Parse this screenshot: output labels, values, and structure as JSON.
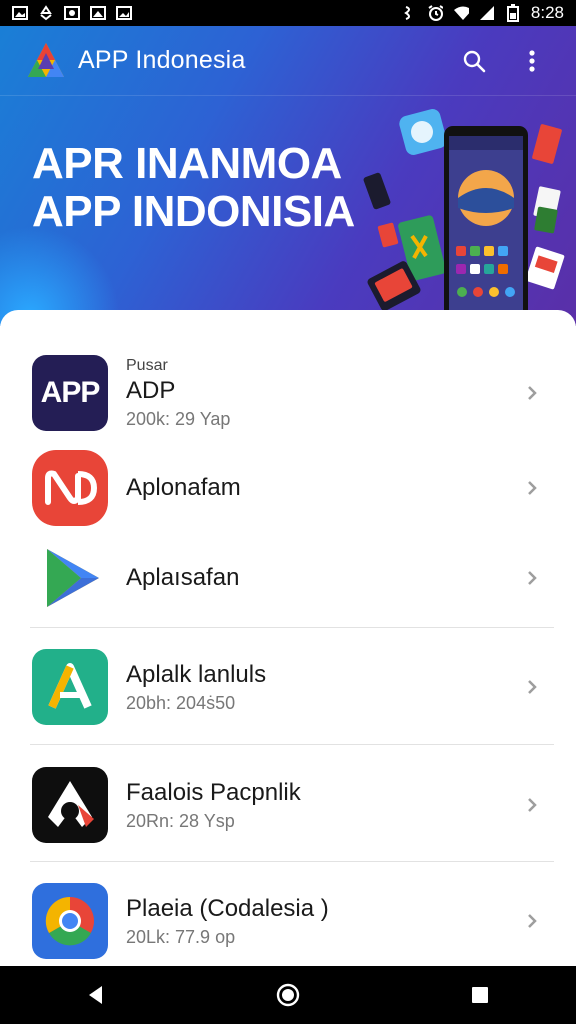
{
  "status_bar": {
    "time": "8:28",
    "left_icons": [
      "gallery-icon",
      "recycle-icon",
      "image-icon",
      "image-icon",
      "image-icon"
    ],
    "right_icons": [
      "vibrate-icon",
      "alarm-icon",
      "wifi-icon",
      "signal-icon",
      "battery-icon"
    ]
  },
  "app_bar": {
    "title": "APP Indonesia",
    "actions": [
      "search-icon",
      "more-vert-icon"
    ]
  },
  "hero": {
    "line1": "APR INANMOA",
    "line2": "APP INDONISIA"
  },
  "list": [
    {
      "kicker": "Pusar",
      "name": "ADP",
      "meta": "200k: 29 Yap",
      "icon": "app-text-icon",
      "icon_text": "APP"
    },
    {
      "kicker": "",
      "name": "Aplonafam",
      "meta": "",
      "icon": "nd-logo-icon"
    },
    {
      "kicker": "",
      "name": "Aplaısafan",
      "meta": "",
      "icon": "play-store-icon"
    },
    {
      "kicker": "",
      "name": "Aplalk lanluls",
      "meta": "20bh: 204ṡ50",
      "icon": "a-logo-icon"
    },
    {
      "kicker": "",
      "name": "Faalois Pacpnlik",
      "meta": "20Rn: 28 Ysp",
      "icon": "bird-logo-icon"
    },
    {
      "kicker": "",
      "name": "Plaeia (Codalesia )",
      "meta": "20Lk: 77.9 op",
      "icon": "chrome-icon"
    }
  ],
  "nav_bar": {
    "buttons": [
      "back-icon",
      "home-icon",
      "recents-icon"
    ]
  },
  "colors": {
    "hero_start": "#1a7fd6",
    "hero_end": "#5a2fa8",
    "accent": "#e84538"
  }
}
